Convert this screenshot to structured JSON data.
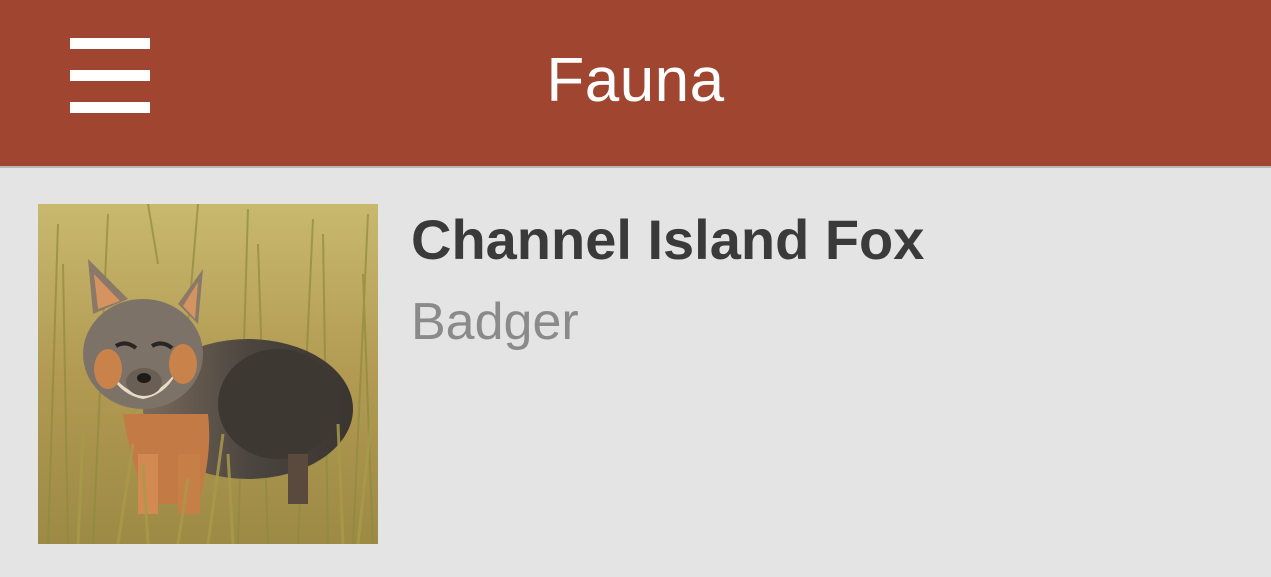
{
  "app": {
    "title": "Fauna",
    "accent_color": "#a0452f",
    "background_color": "#e4e4e4"
  },
  "navbar": {
    "menu_icon": "hamburger-menu-icon"
  },
  "list": {
    "items": [
      {
        "title": "Channel Island Fox",
        "subtitle": "Badger",
        "thumbnail": "fox-in-grass-photo"
      }
    ]
  }
}
